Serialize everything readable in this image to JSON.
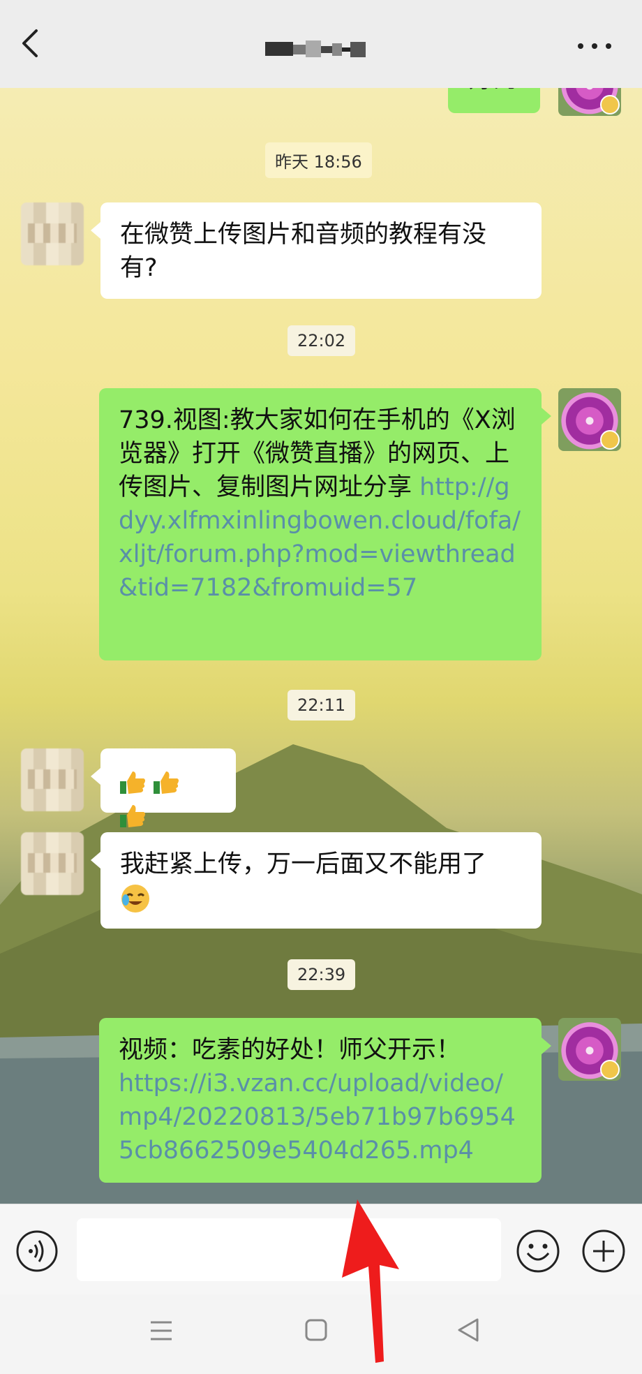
{
  "header": {
    "title": "",
    "back_icon": "chevron-left-icon",
    "more_icon": "more-dots-icon"
  },
  "messages": [
    {
      "id": "partial-top",
      "side": "out",
      "text": "好的"
    },
    {
      "id": "ts1",
      "type": "timestamp",
      "text": "昨天 18:56"
    },
    {
      "id": "m1",
      "side": "in",
      "text": "在微赞上传图片和音频的教程有没有?"
    },
    {
      "id": "ts2",
      "type": "timestamp",
      "text": "22:02"
    },
    {
      "id": "m2",
      "side": "out",
      "text": "739.视图:教大家如何在手机的《X浏览器》打开《微赞直播》的网页、上传图片、复制图片网址分享",
      "link": "http://gdyy.xlfmxinlingbowen.cloud/fofa/xljt/forum.php?mod=viewthread&tid=7182&fromuid=57"
    },
    {
      "id": "ts3",
      "type": "timestamp",
      "text": "22:11"
    },
    {
      "id": "m3",
      "side": "in",
      "emoji": "thumbs-up-x3"
    },
    {
      "id": "m4",
      "side": "in",
      "text": "我赶紧上传，万一后面又不能用了",
      "emoji": "crying-laughing-emoji"
    },
    {
      "id": "ts4",
      "type": "timestamp",
      "text": "22:39"
    },
    {
      "id": "m5",
      "side": "out",
      "text": "视频：吃素的好处！师父开示！",
      "link": "https://i3.vzan.cc/upload/video/mp4/20220813/5eb71b97b69545cb8662509e5404d265.mp4"
    }
  ],
  "inputbar": {
    "voice_icon": "voice-icon",
    "emoji_icon": "smiley-icon",
    "plus_icon": "plus-circle-icon",
    "input_value": ""
  },
  "navbar": {
    "menu_icon": "menu-icon",
    "home_icon": "square-home-icon",
    "back_icon": "triangle-back-icon"
  },
  "colors": {
    "out_bubble": "#95ec69",
    "in_bubble": "#ffffff",
    "link": "#5a8fa8",
    "annotation_arrow": "#ee1c1c"
  }
}
